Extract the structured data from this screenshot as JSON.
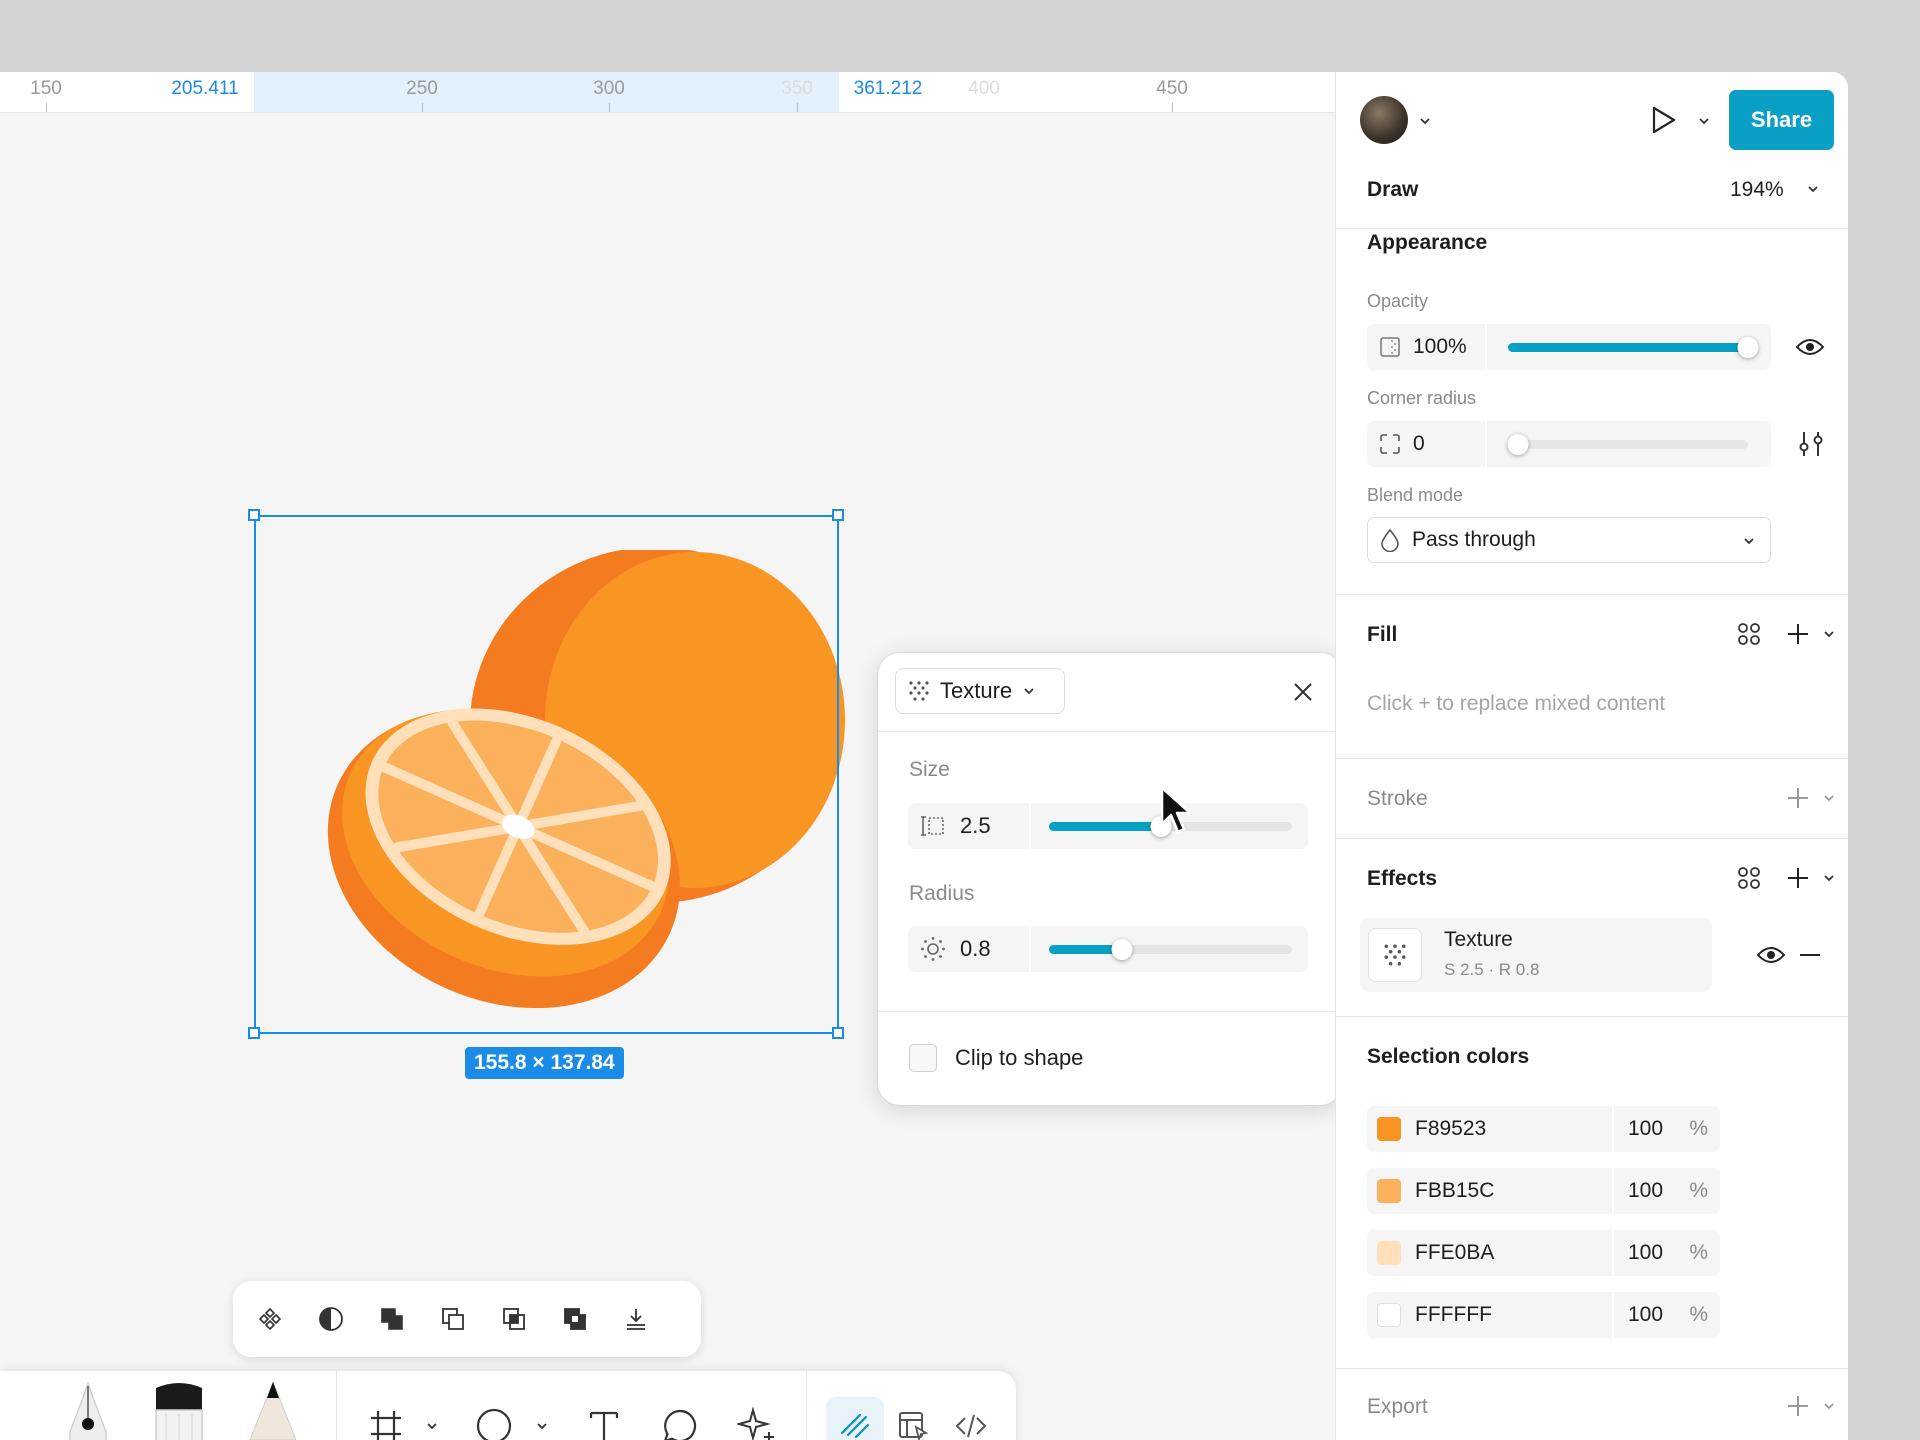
{
  "ruler": {
    "ticks": [
      "150",
      "250",
      "300",
      "350",
      "400",
      "450"
    ],
    "selection_start": "205.411",
    "selection_end": "361.212"
  },
  "canvas": {
    "selection_size": "155.8 × 137.84"
  },
  "texture_popup": {
    "effect_type": "Texture",
    "size_label": "Size",
    "size_value": "2.5",
    "size_fraction": 0.46,
    "radius_label": "Radius",
    "radius_value": "0.8",
    "radius_fraction": 0.3,
    "clip_label": "Clip to shape",
    "clip_checked": false
  },
  "header": {
    "share_label": "Share",
    "mode": "Draw",
    "zoom": "194%"
  },
  "appearance": {
    "title": "Appearance",
    "opacity_label": "Opacity",
    "opacity_value": "100%",
    "opacity_fraction": 1.0,
    "corner_label": "Corner radius",
    "corner_value": "0",
    "corner_fraction": 0.0,
    "blend_label": "Blend mode",
    "blend_value": "Pass through"
  },
  "fill": {
    "title": "Fill",
    "placeholder": "Click + to replace mixed content"
  },
  "stroke": {
    "title": "Stroke"
  },
  "effects": {
    "title": "Effects",
    "item_name": "Texture",
    "item_detail": "S 2.5 · R 0.8"
  },
  "selection_colors": {
    "title": "Selection colors",
    "items": [
      {
        "hex": "F89523",
        "opacity": "100",
        "unit": "%",
        "color": "#F89523"
      },
      {
        "hex": "FBB15C",
        "opacity": "100",
        "unit": "%",
        "color": "#FBB15C"
      },
      {
        "hex": "FFE0BA",
        "opacity": "100",
        "unit": "%",
        "color": "#FFE0BA"
      },
      {
        "hex": "FFFFFF",
        "opacity": "100",
        "unit": "%",
        "color": "#FFFFFF"
      }
    ]
  },
  "export": {
    "title": "Export"
  },
  "colors": {
    "accent": "#0aa0c6",
    "selection_blue": "#1a8be6"
  }
}
